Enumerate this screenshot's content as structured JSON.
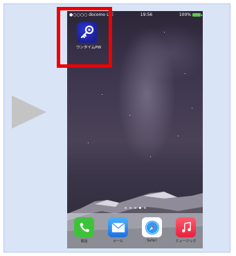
{
  "status_bar": {
    "carrier": "●○○○○ docomo",
    "network": "LTE",
    "time": "19:56",
    "battery": "100%"
  },
  "home_app": {
    "label": "ワンタイムPW",
    "icon": "key-icon"
  },
  "page_dots": {
    "count": 5,
    "active_index": 3
  },
  "dock": [
    {
      "label": "電話",
      "icon": "phone-icon",
      "color": "#3fc23b"
    },
    {
      "label": "メール",
      "icon": "mail-icon",
      "color": "#2e8ef0"
    },
    {
      "label": "Safari",
      "icon": "compass-icon",
      "color": "#ffffff"
    },
    {
      "label": "ミュージック",
      "icon": "music-note-icon",
      "color": "#f0394f"
    }
  ],
  "colors": {
    "highlight_frame": "#ee0000",
    "panel_background": "#d9e5f7",
    "arrow": "#c4c4c4"
  }
}
